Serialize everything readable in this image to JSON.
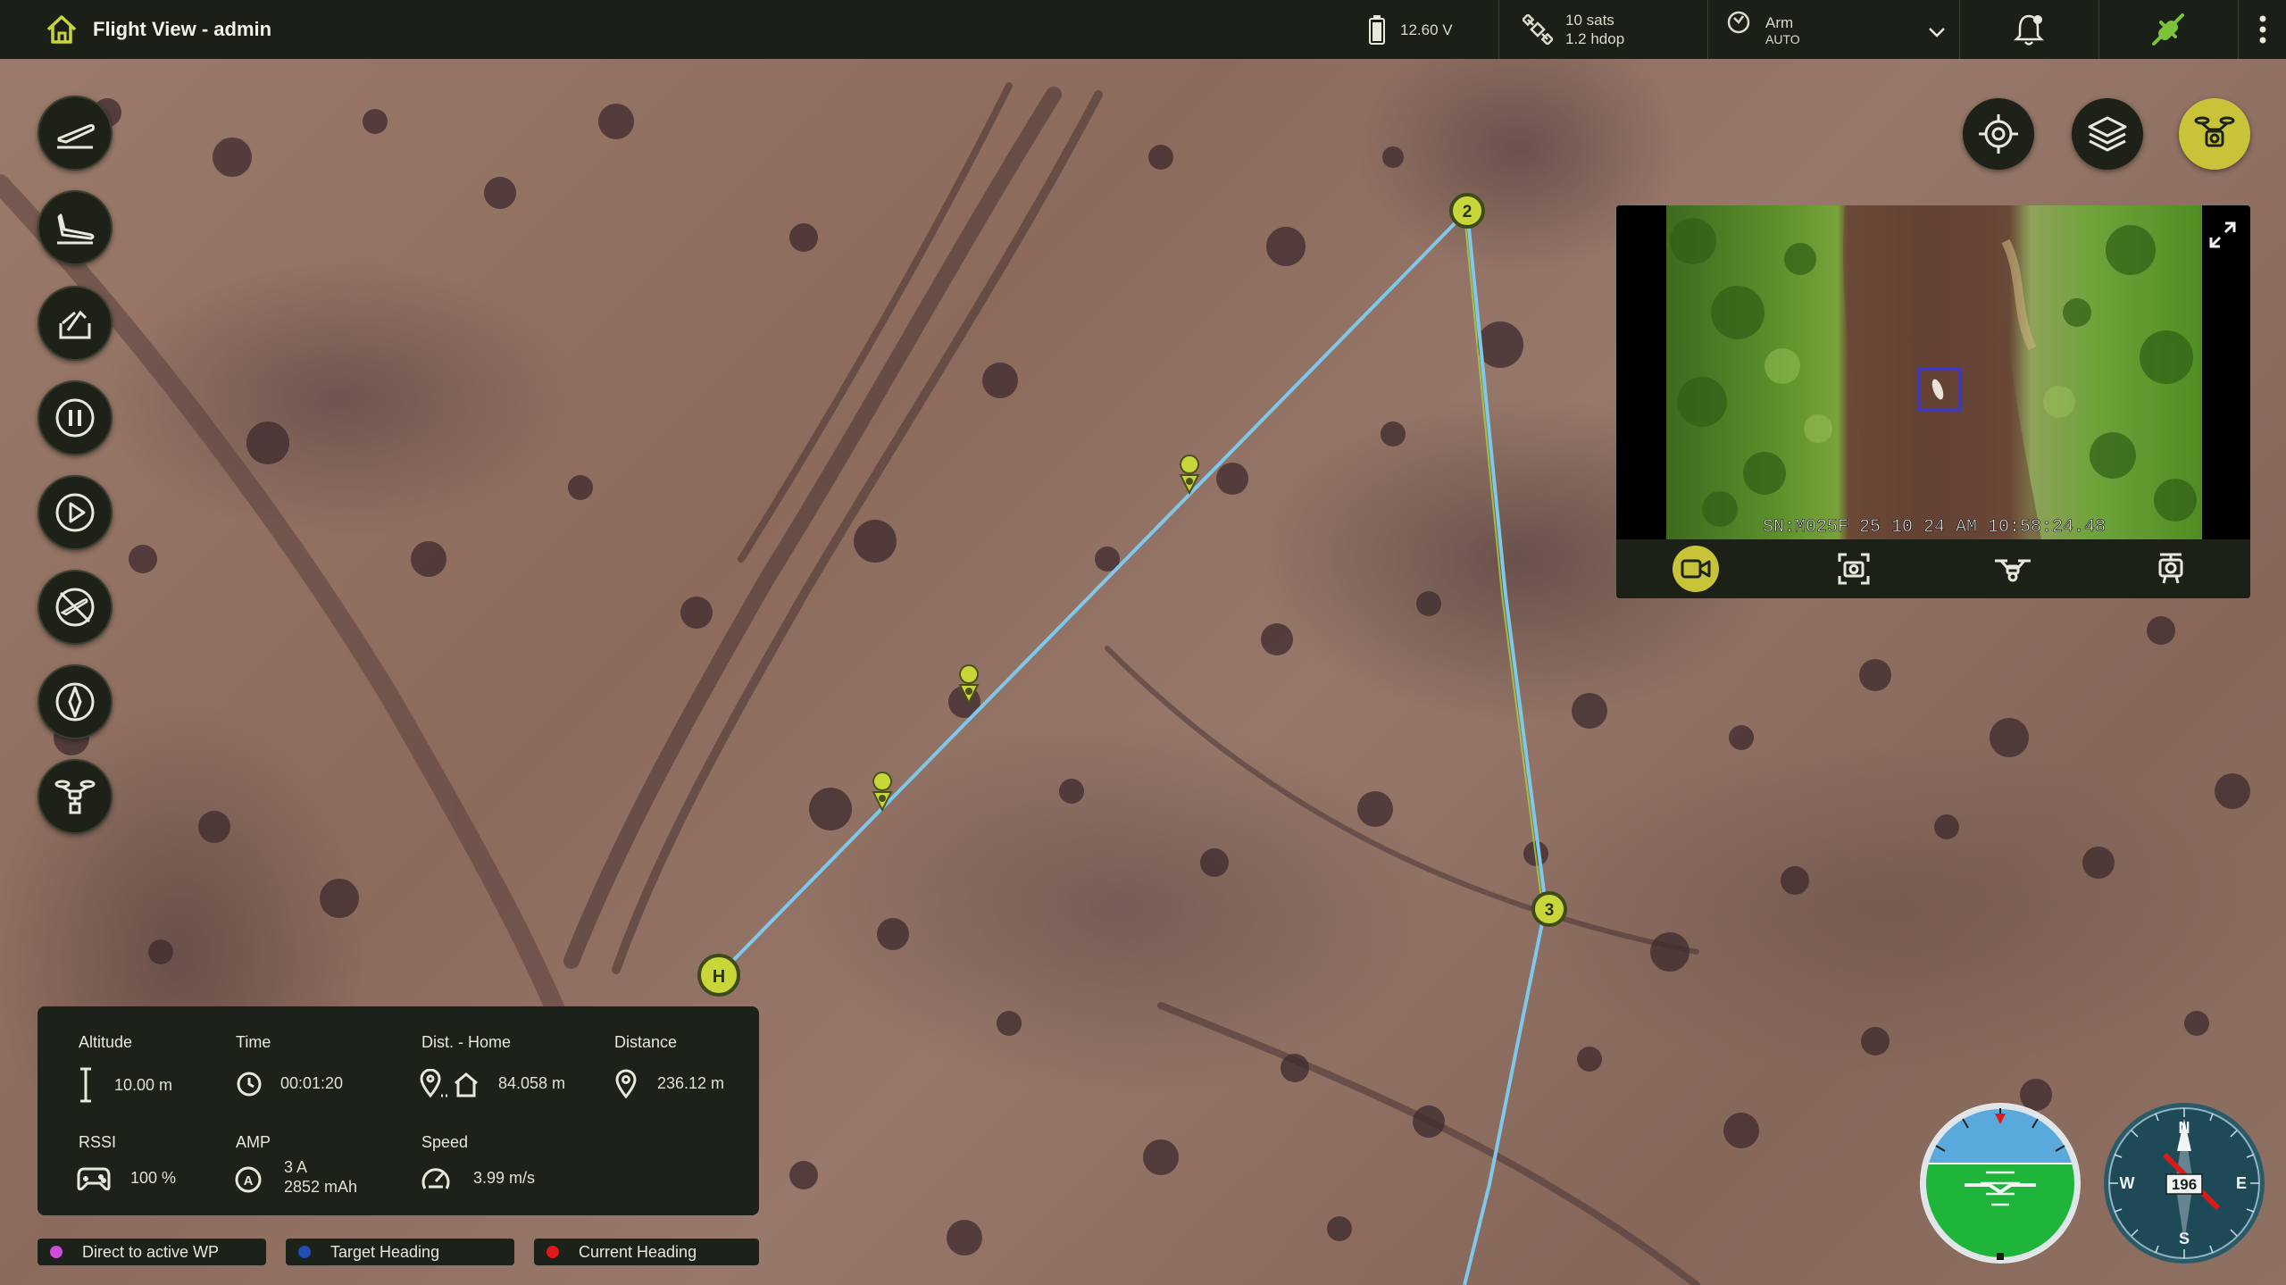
{
  "app": {
    "title": "Flight View - admin"
  },
  "status": {
    "battery_voltage": "12.60 V",
    "gps_sats": "10 sats",
    "gps_hdop": "1.2 hdop",
    "arm_label": "Arm",
    "mode": "AUTO"
  },
  "map": {
    "waypoints": [
      "H",
      "2",
      "3"
    ],
    "path_color": "#7ec8ea",
    "waypoint_color": "#c9d63a"
  },
  "video": {
    "overlay_text": "SN:M025F 25 10 24 AM  10:58:24.48"
  },
  "telemetry": {
    "altitude": {
      "label": "Altitude",
      "value": "10.00 m"
    },
    "time": {
      "label": "Time",
      "value": "00:01:20"
    },
    "dist_home": {
      "label": "Dist. - Home",
      "value": "84.058 m"
    },
    "distance": {
      "label": "Distance",
      "value": "236.12 m"
    },
    "rssi": {
      "label": "RSSI",
      "value": "100 %"
    },
    "amp": {
      "label": "AMP",
      "value_current": "3 A",
      "value_capacity": "2852 mAh"
    },
    "speed": {
      "label": "Speed",
      "value": "3.99 m/s"
    }
  },
  "legend": [
    {
      "label": "Direct to active WP",
      "color": "#d04bd8"
    },
    {
      "label": "Target Heading",
      "color": "#1f4fb0"
    },
    {
      "label": "Current Heading",
      "color": "#e01818"
    }
  ],
  "compass": {
    "heading": "196",
    "n": "N",
    "e": "E",
    "s": "S",
    "w": "W"
  }
}
